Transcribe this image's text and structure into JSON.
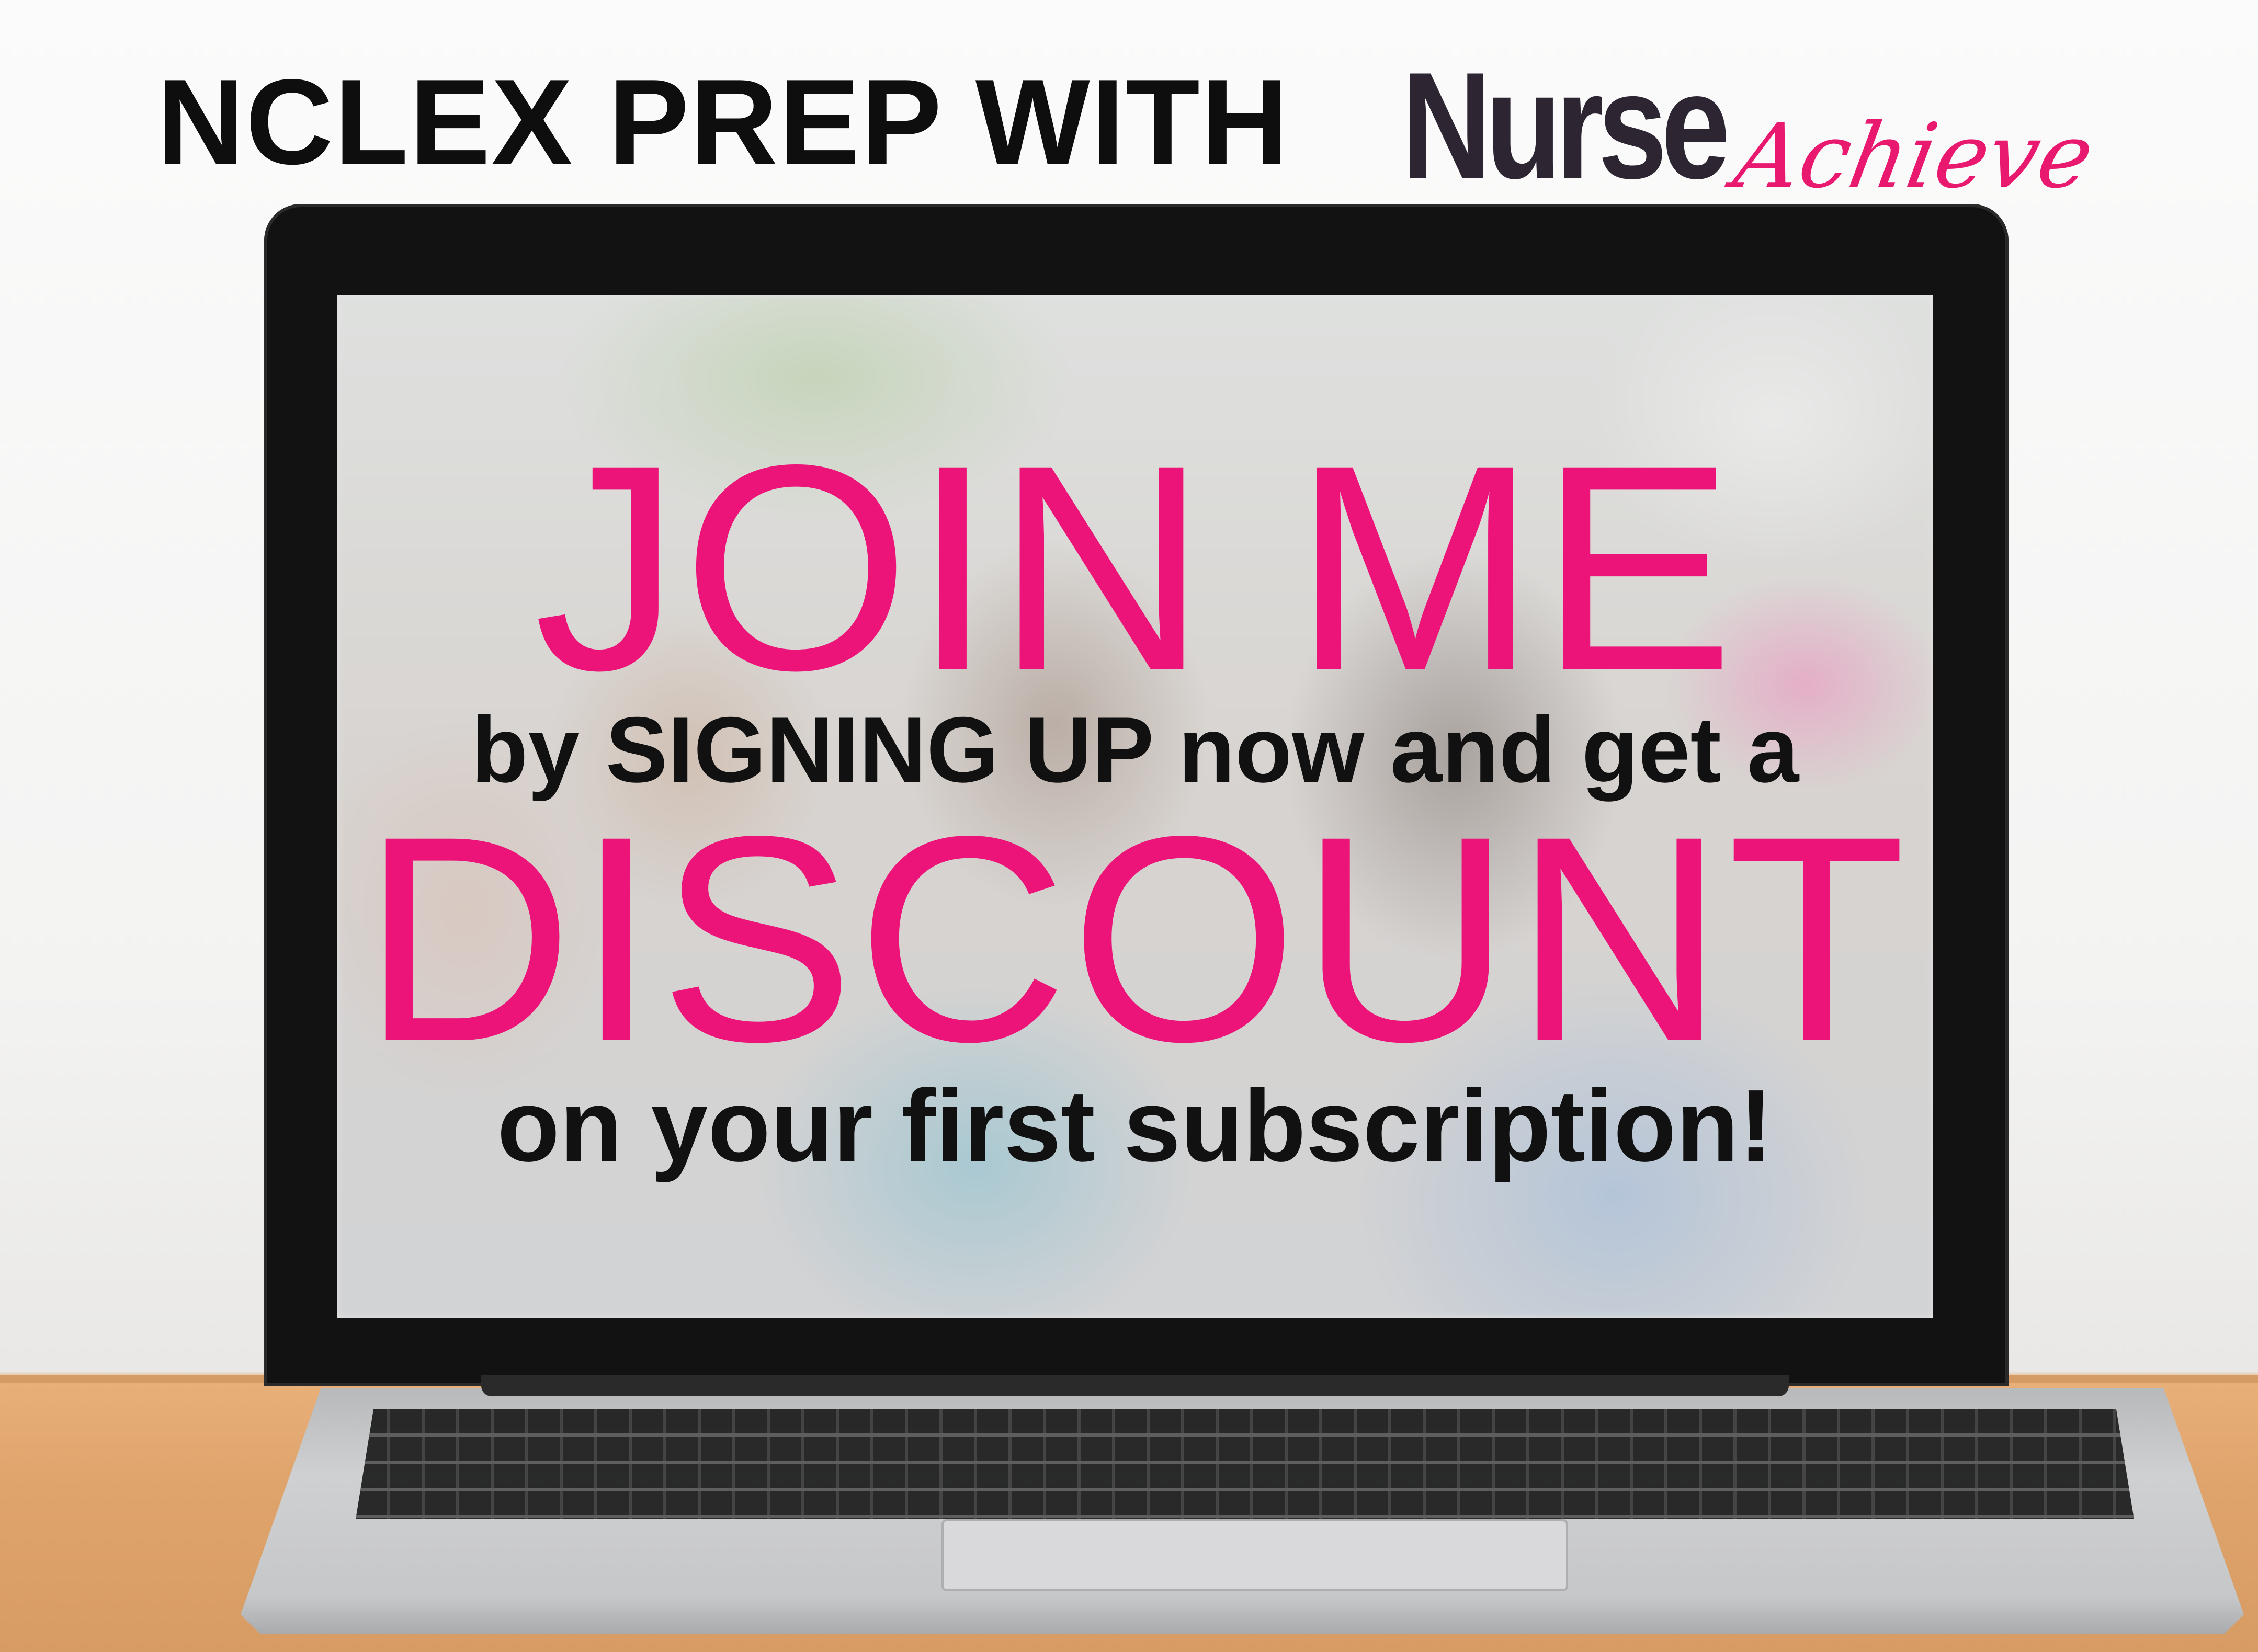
{
  "header": {
    "headline": "NCLEX PREP WITH",
    "logo": {
      "word_primary": "Nurse",
      "word_secondary": "Achieve"
    }
  },
  "screen": {
    "line1": "JOIN ME",
    "line2": "by SIGNING UP now and get a",
    "line3": "DISCOUNT",
    "line4": "on your first subscription!"
  },
  "colors": {
    "accent_pink": "#ec1479",
    "logo_dark": "#2e2533",
    "text_dark": "#111111"
  }
}
